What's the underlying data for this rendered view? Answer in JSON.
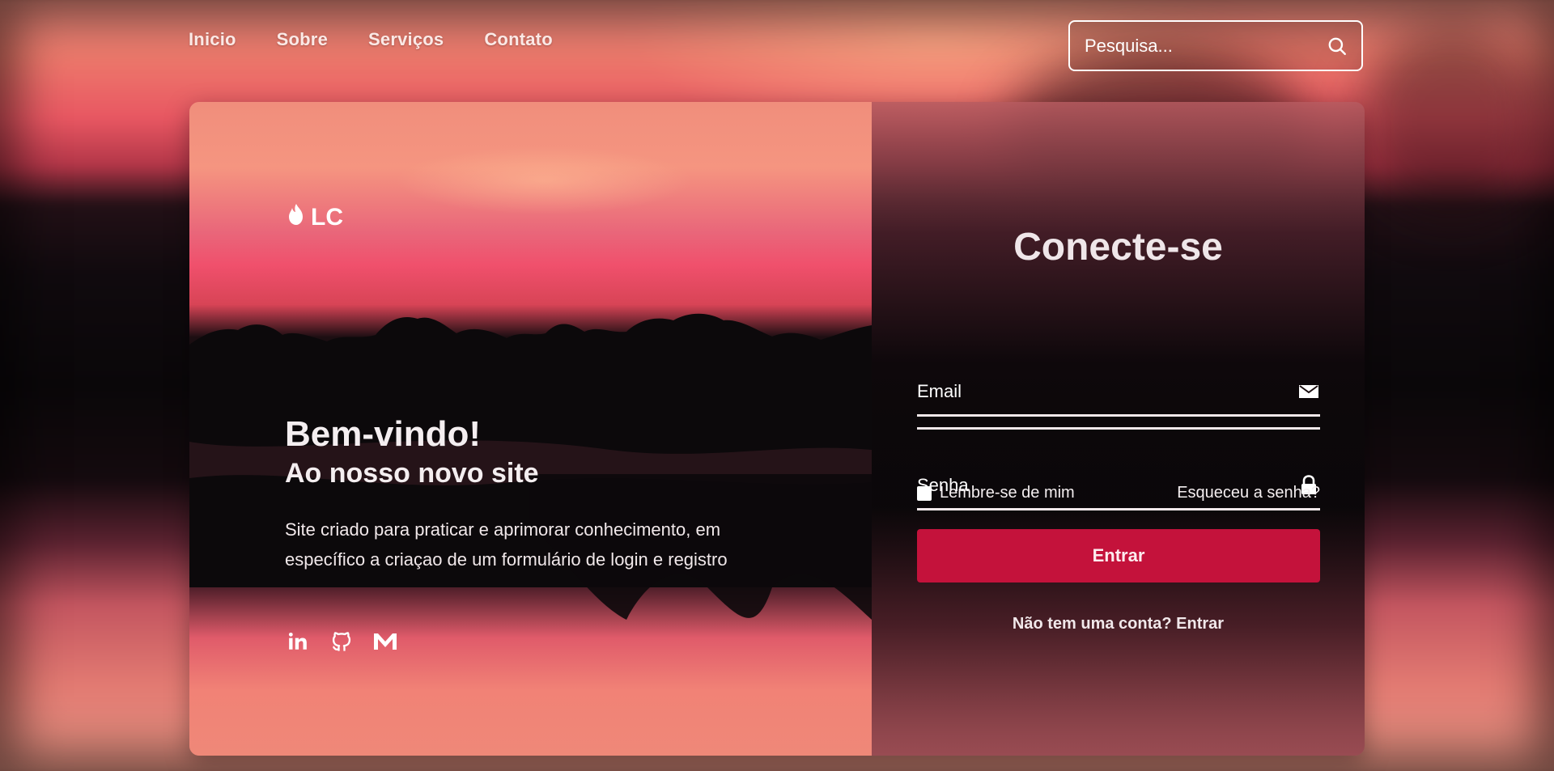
{
  "nav": {
    "items": [
      {
        "label": "Inicio"
      },
      {
        "label": "Sobre"
      },
      {
        "label": "Serviços"
      },
      {
        "label": "Contato"
      }
    ]
  },
  "search": {
    "placeholder": "Pesquisa...",
    "icon": "search-icon"
  },
  "hero": {
    "logo_text": "LC",
    "logo_icon": "flame-icon",
    "title": "Bem-vindo!",
    "subtitle": "Ao nosso novo site",
    "description": "Site criado para praticar e aprimorar conhecimento, em específico a criaçao de um formulário de login e registro",
    "socials": [
      "linkedin-icon",
      "github-icon",
      "gmail-icon"
    ]
  },
  "login": {
    "title": "Conecte-se",
    "email_placeholder": "Email",
    "email_icon": "envelope-icon",
    "password_placeholder": "Senha",
    "password_icon": "lock-icon",
    "remember_label": "Lembre-se de mim",
    "forgot_label": "Esqueceu a senha?",
    "submit_label": "Entrar",
    "register_prompt": "Não tem uma conta?",
    "register_link": "Entrar"
  },
  "colors": {
    "accent": "#c4123b",
    "text": "#f4eef0"
  }
}
